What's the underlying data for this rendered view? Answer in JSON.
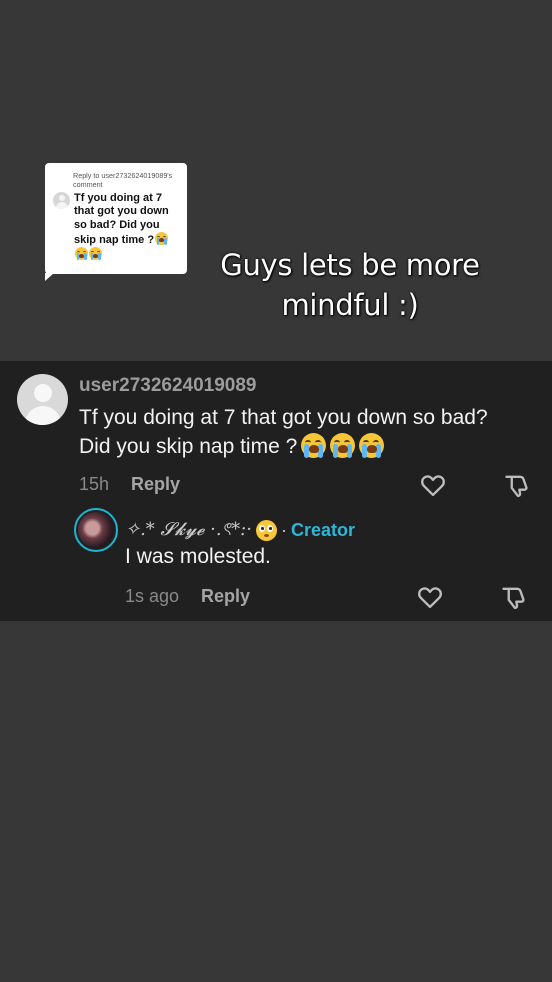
{
  "sticker": {
    "header": "Reply to user2732624019089's comment",
    "text": "Tf you doing at 7 that got you down so bad? Did you skip nap time ?"
  },
  "caption": {
    "line1": "Guys lets be more",
    "line2": "mindful :)"
  },
  "comment": {
    "username": "user2732624019089",
    "text": "Tf you doing at 7 that got you down so bad? Did you skip nap time ?",
    "emoji": [
      "loudly-crying-face",
      "loudly-crying-face",
      "loudly-crying-face"
    ],
    "time": "15h",
    "reply_label": "Reply"
  },
  "reply": {
    "username_prefix": "✧.* 𝓢𝓴𝔂𝓮 ·.ৎ*:·",
    "username_emoji": "flushed-face",
    "separator": "·",
    "creator_label": "Creator",
    "text": "I was molested.",
    "time": "1s ago",
    "reply_label": "Reply"
  },
  "colors": {
    "background": "#373737",
    "panel": "#202020",
    "creator": "#2fb6d6"
  }
}
